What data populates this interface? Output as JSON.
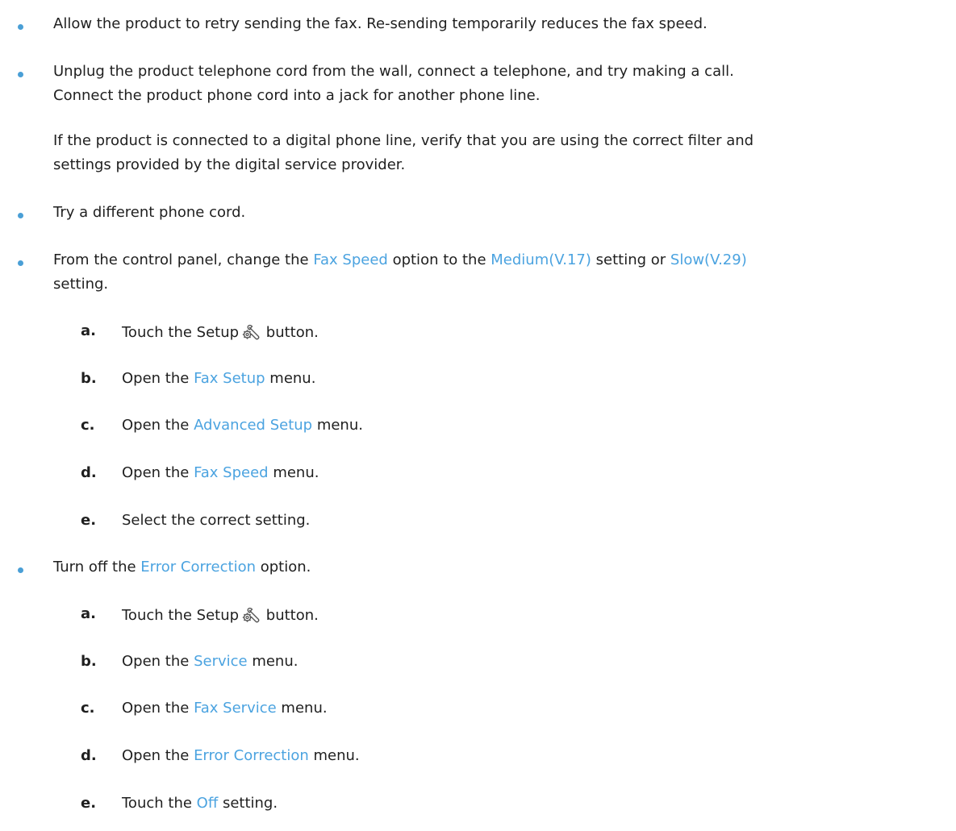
{
  "bullets": [
    {
      "lines": [
        "Allow the product to retry sending the fax. Re-sending temporarily reduces the fax speed."
      ]
    },
    {
      "lines": [
        "Unplug the product telephone cord from the wall, connect a telephone, and try making a call.",
        "Connect the product phone cord into a jack for another phone line."
      ],
      "paragraph": [
        "If the product is connected to a digital phone line, verify that you are using the correct filter and",
        "settings provided by the digital service provider."
      ]
    },
    {
      "lines": [
        "Try a different phone cord."
      ]
    },
    {
      "line1_pre": "From the control panel, change the ",
      "line1_link1": "Fax Speed",
      "line1_mid": " option to the ",
      "line1_link2": "Medium(V.17)",
      "line1_mid2": " setting or ",
      "line1_link3": "Slow(V.29)",
      "line2": "setting.",
      "steps": [
        {
          "letter": "a.",
          "pre": "Touch the Setup",
          "icon": "setup-wrench-gear-icon",
          "post": " button."
        },
        {
          "letter": "b.",
          "pre": "Open the ",
          "link": "Fax Setup",
          "post": " menu."
        },
        {
          "letter": "c.",
          "pre": "Open the ",
          "link": "Advanced Setup",
          "post": " menu."
        },
        {
          "letter": "d.",
          "pre": "Open the ",
          "link": "Fax Speed",
          "post": " menu."
        },
        {
          "letter": "e.",
          "pre": "Select the correct setting."
        }
      ]
    },
    {
      "line1_pre": "Turn off the ",
      "line1_link": "Error Correction",
      "line1_post": " option.",
      "steps": [
        {
          "letter": "a.",
          "pre": "Touch the Setup",
          "icon": "setup-wrench-gear-icon",
          "post": " button."
        },
        {
          "letter": "b.",
          "pre": "Open the ",
          "link": "Service",
          "post": " menu."
        },
        {
          "letter": "c.",
          "pre": "Open the ",
          "link": "Fax Service",
          "post": " menu."
        },
        {
          "letter": "d.",
          "pre": "Open the ",
          "link": "Error Correction",
          "post": " menu."
        },
        {
          "letter": "e.",
          "pre": "Touch the ",
          "link": "Off",
          "post": " setting."
        }
      ]
    }
  ],
  "colors": {
    "bullet": "#4a9fd6",
    "link": "#4ba3e0",
    "text": "#1f1f1f"
  }
}
